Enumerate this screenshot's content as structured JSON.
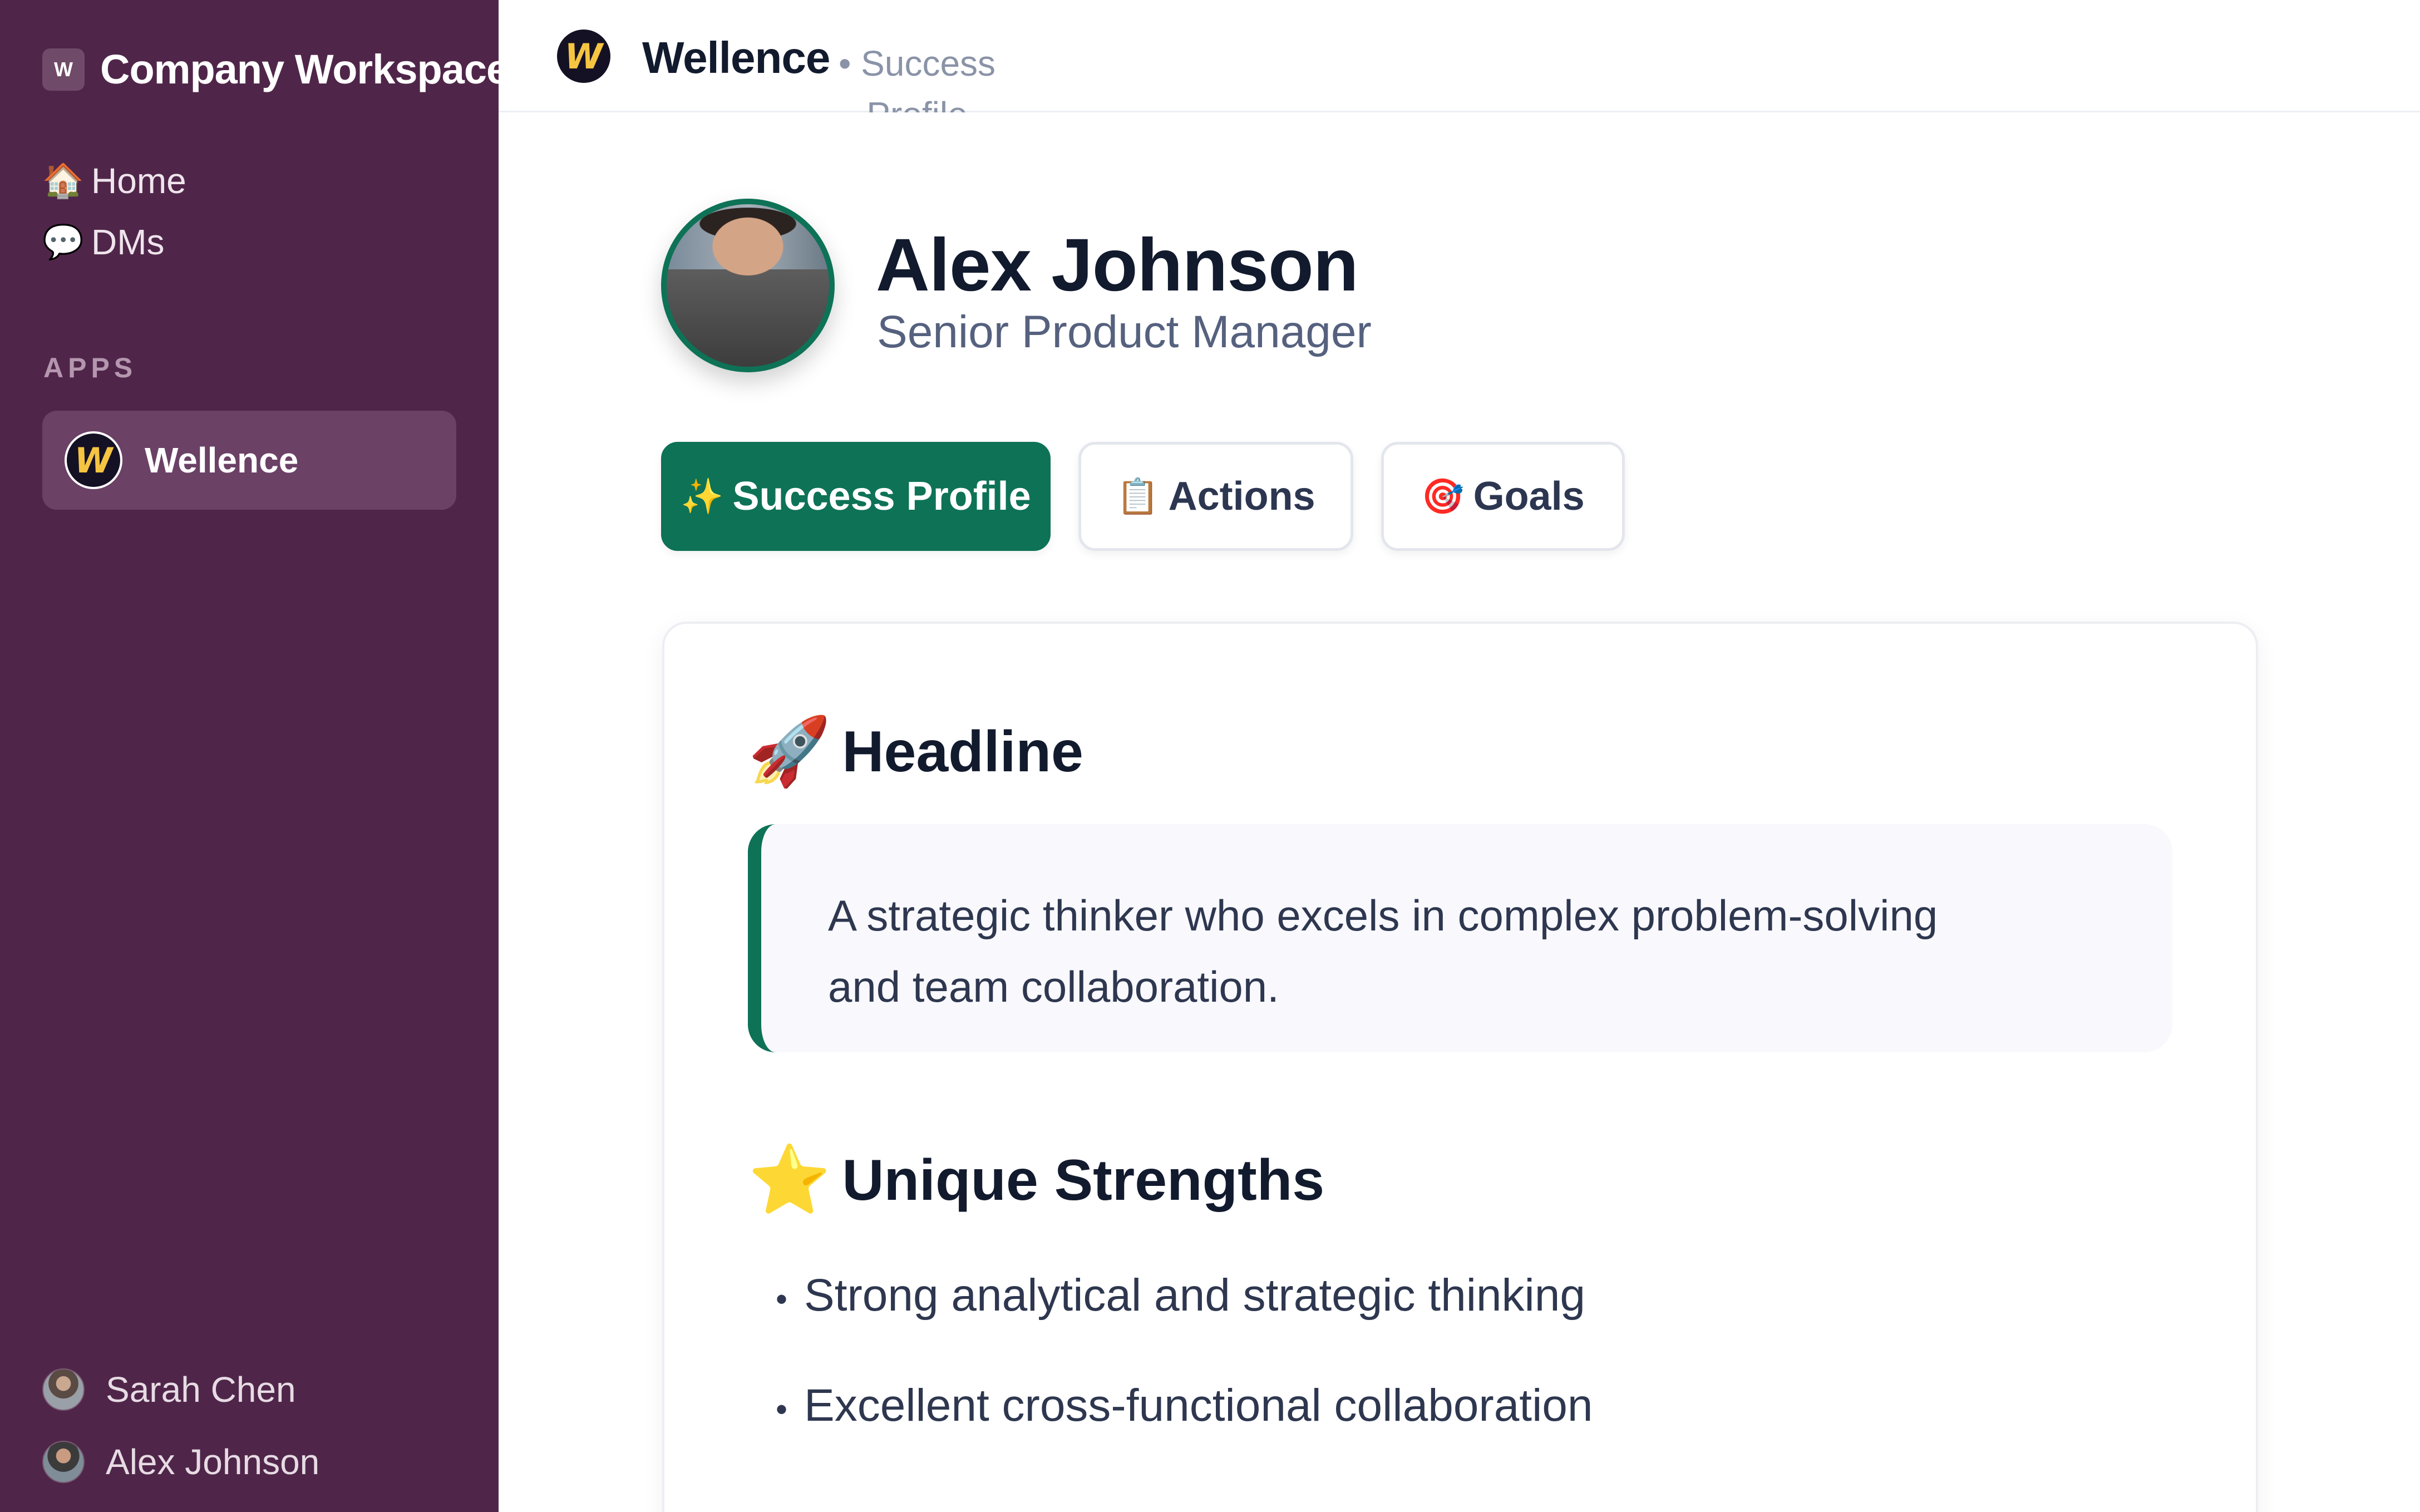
{
  "sidebar": {
    "workspace_logo": "W",
    "workspace_name": "Company Workspace",
    "nav": [
      {
        "icon": "house-icon",
        "emoji": "🏠",
        "label": "Home"
      },
      {
        "icon": "speech-bubble-icon",
        "emoji": "💬",
        "label": "DMs"
      }
    ],
    "section_label": "APPS",
    "app": {
      "name": "Wellence",
      "logo": "W"
    },
    "users": [
      {
        "name": "Sarah Chen"
      },
      {
        "name": "Alex Johnson"
      }
    ]
  },
  "topbar": {
    "title": "Wellence",
    "subtitle": "• Success Profile",
    "logo": "W"
  },
  "profile": {
    "name": "Alex Johnson",
    "role": "Senior Product Manager"
  },
  "tabs": [
    {
      "emoji": "✨",
      "icon": "sparkles-icon",
      "label": "Success Profile",
      "active": true
    },
    {
      "emoji": "📋",
      "icon": "clipboard-icon",
      "label": "Actions",
      "active": false
    },
    {
      "emoji": "🎯",
      "icon": "target-icon",
      "label": "Goals",
      "active": false
    }
  ],
  "content": {
    "headline": {
      "emoji": "🚀",
      "title": "Headline",
      "text": "A strategic thinker who excels in complex problem-solving and team collaboration."
    },
    "strengths": {
      "emoji": "⭐",
      "title": "Unique Strengths",
      "items": [
        "Strong analytical and strategic thinking",
        "Excellent cross-functional collaboration"
      ]
    }
  },
  "colors": {
    "sidebar_bg": "#4f2649",
    "active_app_bg": "#6b4166",
    "accent": "#0e7256",
    "text_dark": "#121a2e",
    "text_muted": "#55617e"
  }
}
